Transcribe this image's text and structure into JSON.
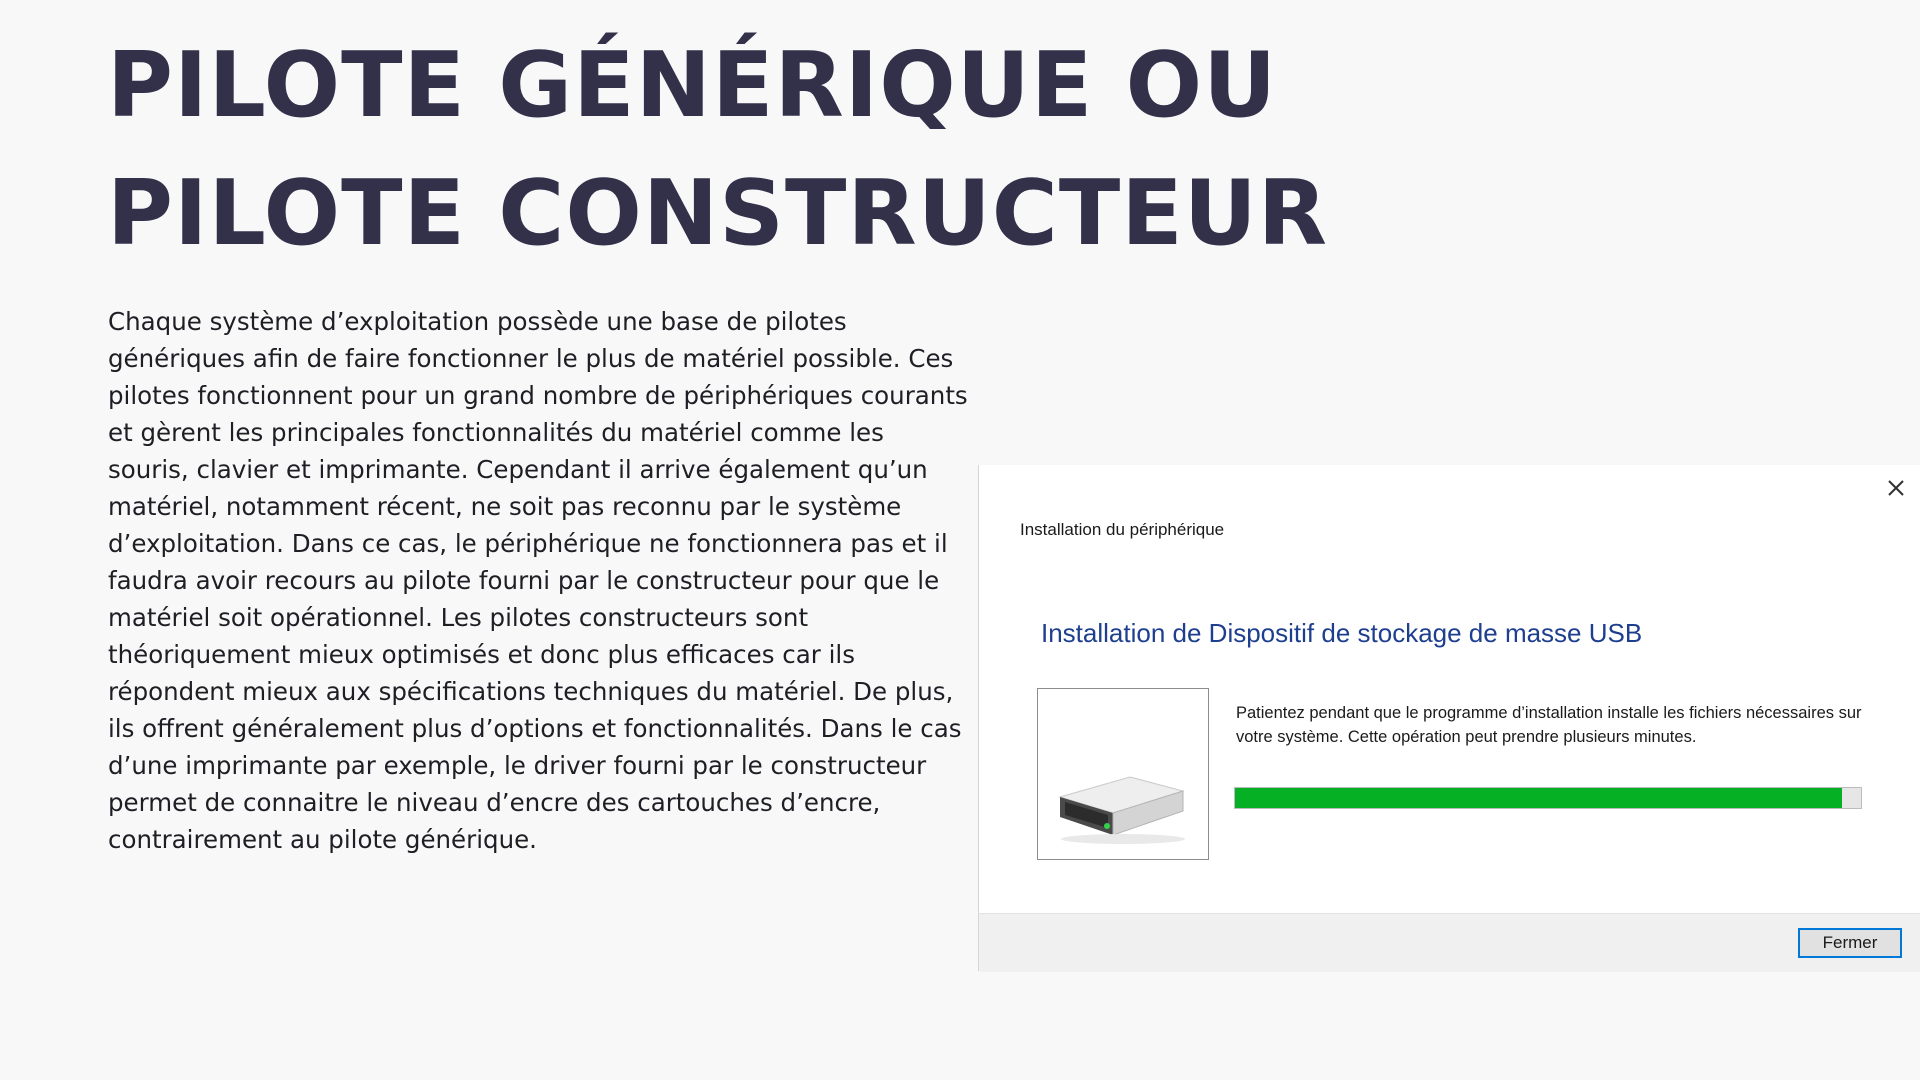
{
  "slide": {
    "title": "PILOTE GÉNÉRIQUE OU PILOTE CONSTRUCTEUR",
    "body": "Chaque système d’exploitation possède une base de pilotes génériques afin de faire fonctionner le plus de matériel possible. Ces pilotes fonctionnent pour un grand nombre de périphériques courants et gèrent les principales fonctionnalités du matériel comme les souris, clavier et imprimante. Cependant il arrive également qu’un matériel, notamment récent, ne soit pas reconnu par le système d’exploitation. Dans ce cas, le périphérique ne fonctionnera pas et il faudra avoir recours au pilote fourni par le constructeur pour que le matériel soit opérationnel. Les pilotes constructeurs sont théoriquement mieux optimisés et donc plus efficaces car ils répondent mieux aux spécifications techniques du matériel. De plus, ils offrent généralement plus d’options et fonctionnalités. Dans le cas d’une imprimante par exemple, le driver fourni par le constructeur permet de connaitre le niveau d’encre des cartouches d’encre, contrairement au pilote générique."
  },
  "dialog": {
    "window_title": "Installation du périphérique",
    "heading": "Installation de Dispositif de stockage de masse USB",
    "message": "Patientez pendant que le programme d’installation installe les fichiers nécessaires sur votre système. Cette opération peut prendre plusieurs minutes.",
    "progress_percent": 97,
    "close_button_label": "Fermer",
    "device_icon": "usb-drive-icon",
    "close_icon": "close-icon",
    "colors": {
      "progress_fill": "#06b025",
      "heading": "#1e3f8f",
      "button_border": "#0078d7"
    }
  }
}
